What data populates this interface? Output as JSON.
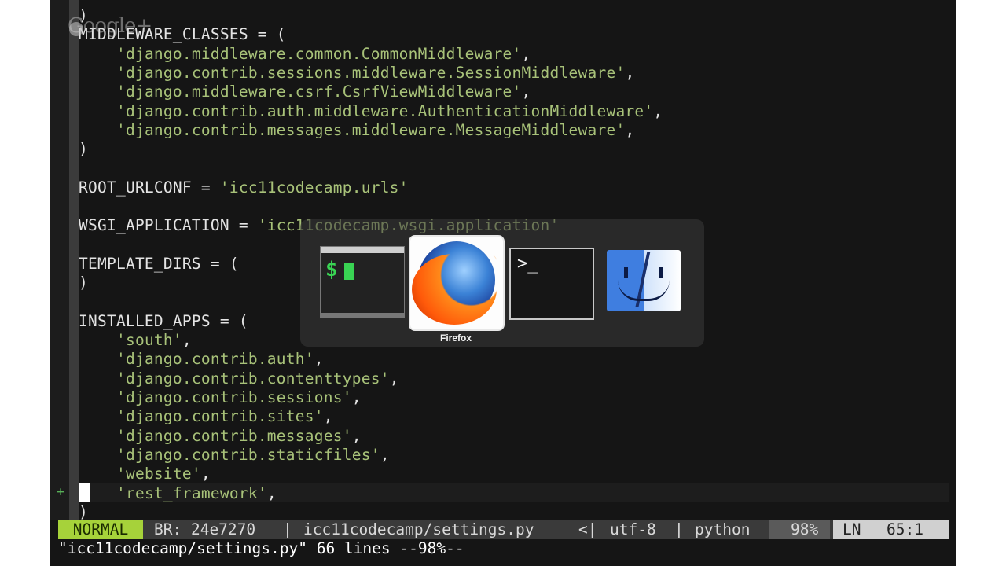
{
  "watermark": {
    "text": "Google+"
  },
  "editor": {
    "lines": [
      {
        "code": ")",
        "str": ""
      },
      {
        "code": "MIDDLEWARE_CLASSES = (",
        "str": ""
      },
      {
        "code": "    ",
        "str": "'django.middleware.common.CommonMiddleware'",
        "tail": ","
      },
      {
        "code": "    ",
        "str": "'django.contrib.sessions.middleware.SessionMiddleware'",
        "tail": ","
      },
      {
        "code": "    ",
        "str": "'django.middleware.csrf.CsrfViewMiddleware'",
        "tail": ","
      },
      {
        "code": "    ",
        "str": "'django.contrib.auth.middleware.AuthenticationMiddleware'",
        "tail": ","
      },
      {
        "code": "    ",
        "str": "'django.contrib.messages.middleware.MessageMiddleware'",
        "tail": ","
      },
      {
        "code": ")",
        "str": ""
      },
      {
        "code": "",
        "str": ""
      },
      {
        "code": "ROOT_URLCONF = ",
        "str": "'icc11codecamp.urls'"
      },
      {
        "code": "",
        "str": ""
      },
      {
        "code": "WSGI_APPLICATION = ",
        "str": "'icc11codecamp.wsgi.application'"
      },
      {
        "code": "",
        "str": ""
      },
      {
        "code": "TEMPLATE_DIRS = (",
        "str": ""
      },
      {
        "code": ")",
        "str": ""
      },
      {
        "code": "",
        "str": ""
      },
      {
        "code": "INSTALLED_APPS = (",
        "str": ""
      },
      {
        "code": "    ",
        "str": "'south'",
        "tail": ","
      },
      {
        "code": "    ",
        "str": "'django.contrib.auth'",
        "tail": ","
      },
      {
        "code": "    ",
        "str": "'django.contrib.contenttypes'",
        "tail": ","
      },
      {
        "code": "    ",
        "str": "'django.contrib.sessions'",
        "tail": ","
      },
      {
        "code": "    ",
        "str": "'django.contrib.sites'",
        "tail": ","
      },
      {
        "code": "    ",
        "str": "'django.contrib.messages'",
        "tail": ","
      },
      {
        "code": "    ",
        "str": "'django.contrib.staticfiles'",
        "tail": ","
      },
      {
        "code": "    ",
        "str": "'website'",
        "tail": ","
      },
      {
        "code": "    ",
        "str": "'rest_framework'",
        "tail": ","
      },
      {
        "code": ")",
        "str": ""
      }
    ],
    "sign_marker": "+"
  },
  "statusline": {
    "mode": "NORMAL",
    "branch": "BR: 24e7270",
    "sep1": "|",
    "filename": "icc11codecamp/settings.py",
    "sep2": "<|",
    "encoding": "utf-8",
    "sep3": "|",
    "filetype": "python",
    "percent": "98%",
    "ln_label": "LN",
    "position": "65:1"
  },
  "cmdline": "\"icc11codecamp/settings.py\" 66 lines --98%--",
  "app_switcher": {
    "apps": [
      {
        "icon": "terminal-green-icon",
        "prompt": "$"
      },
      {
        "icon": "firefox-icon",
        "label": "Firefox"
      },
      {
        "icon": "terminal-icon",
        "prompt": ">_"
      },
      {
        "icon": "finder-icon"
      }
    ],
    "selected_label": "Firefox"
  },
  "colors": {
    "background": "#151515",
    "string": "#a8c279",
    "mode_bg": "#a6d23a",
    "statusline_bg": "#3a3a3a"
  }
}
